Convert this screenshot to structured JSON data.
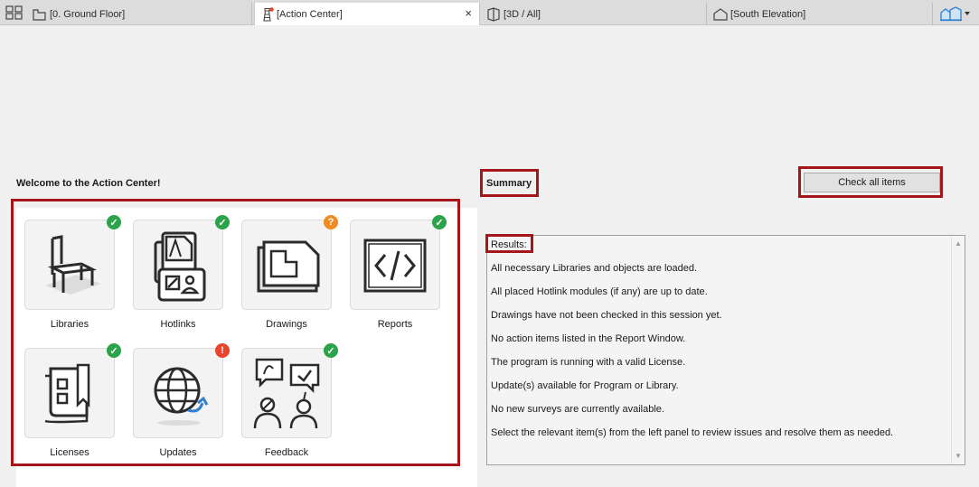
{
  "tabs": [
    {
      "label": "[0. Ground Floor]",
      "icon": "floor-plan-icon"
    },
    {
      "label": "[Action Center]",
      "icon": "lighthouse-icon",
      "close": "×"
    },
    {
      "label": "[3D / All]",
      "icon": "cube-3d-icon"
    },
    {
      "label": "[South Elevation]",
      "icon": "elevation-icon"
    }
  ],
  "view_menu_icon": "buildings-icon",
  "welcome": "Welcome to the Action Center!",
  "tiles": [
    {
      "label": "Libraries",
      "icon": "chair-icon",
      "status": "ok",
      "badge": "✓"
    },
    {
      "label": "Hotlinks",
      "icon": "hotlink-documents-icon",
      "status": "ok",
      "badge": "✓"
    },
    {
      "label": "Drawings",
      "icon": "drawing-sheets-icon",
      "status": "unknown",
      "badge": "?"
    },
    {
      "label": "Reports",
      "icon": "code-report-icon",
      "status": "ok",
      "badge": "✓"
    },
    {
      "label": "Licenses",
      "icon": "license-book-icon",
      "status": "ok",
      "badge": "✓"
    },
    {
      "label": "Updates",
      "icon": "globe-update-icon",
      "status": "warning",
      "badge": "!"
    },
    {
      "label": "Feedback",
      "icon": "feedback-people-icon",
      "status": "ok",
      "badge": "✓"
    }
  ],
  "status_colors": {
    "ok": "#2aa34a",
    "unknown": "#f08a24",
    "warning": "#e8452c"
  },
  "summary": {
    "title": "Summary",
    "check_button": "Check all items",
    "results_label": "Results:",
    "lines": [
      "All necessary Libraries and objects are loaded.",
      "All placed Hotlink modules (if any) are up to date.",
      "Drawings have not been checked in this session yet.",
      "No action items listed in the Report Window.",
      "The program is running with a valid License.",
      "Update(s) available for Program or Library.",
      "No new surveys are currently available.",
      "Select the relevant item(s) from the left panel to review issues and resolve them as needed."
    ]
  },
  "highlight_color": "#a4161a"
}
